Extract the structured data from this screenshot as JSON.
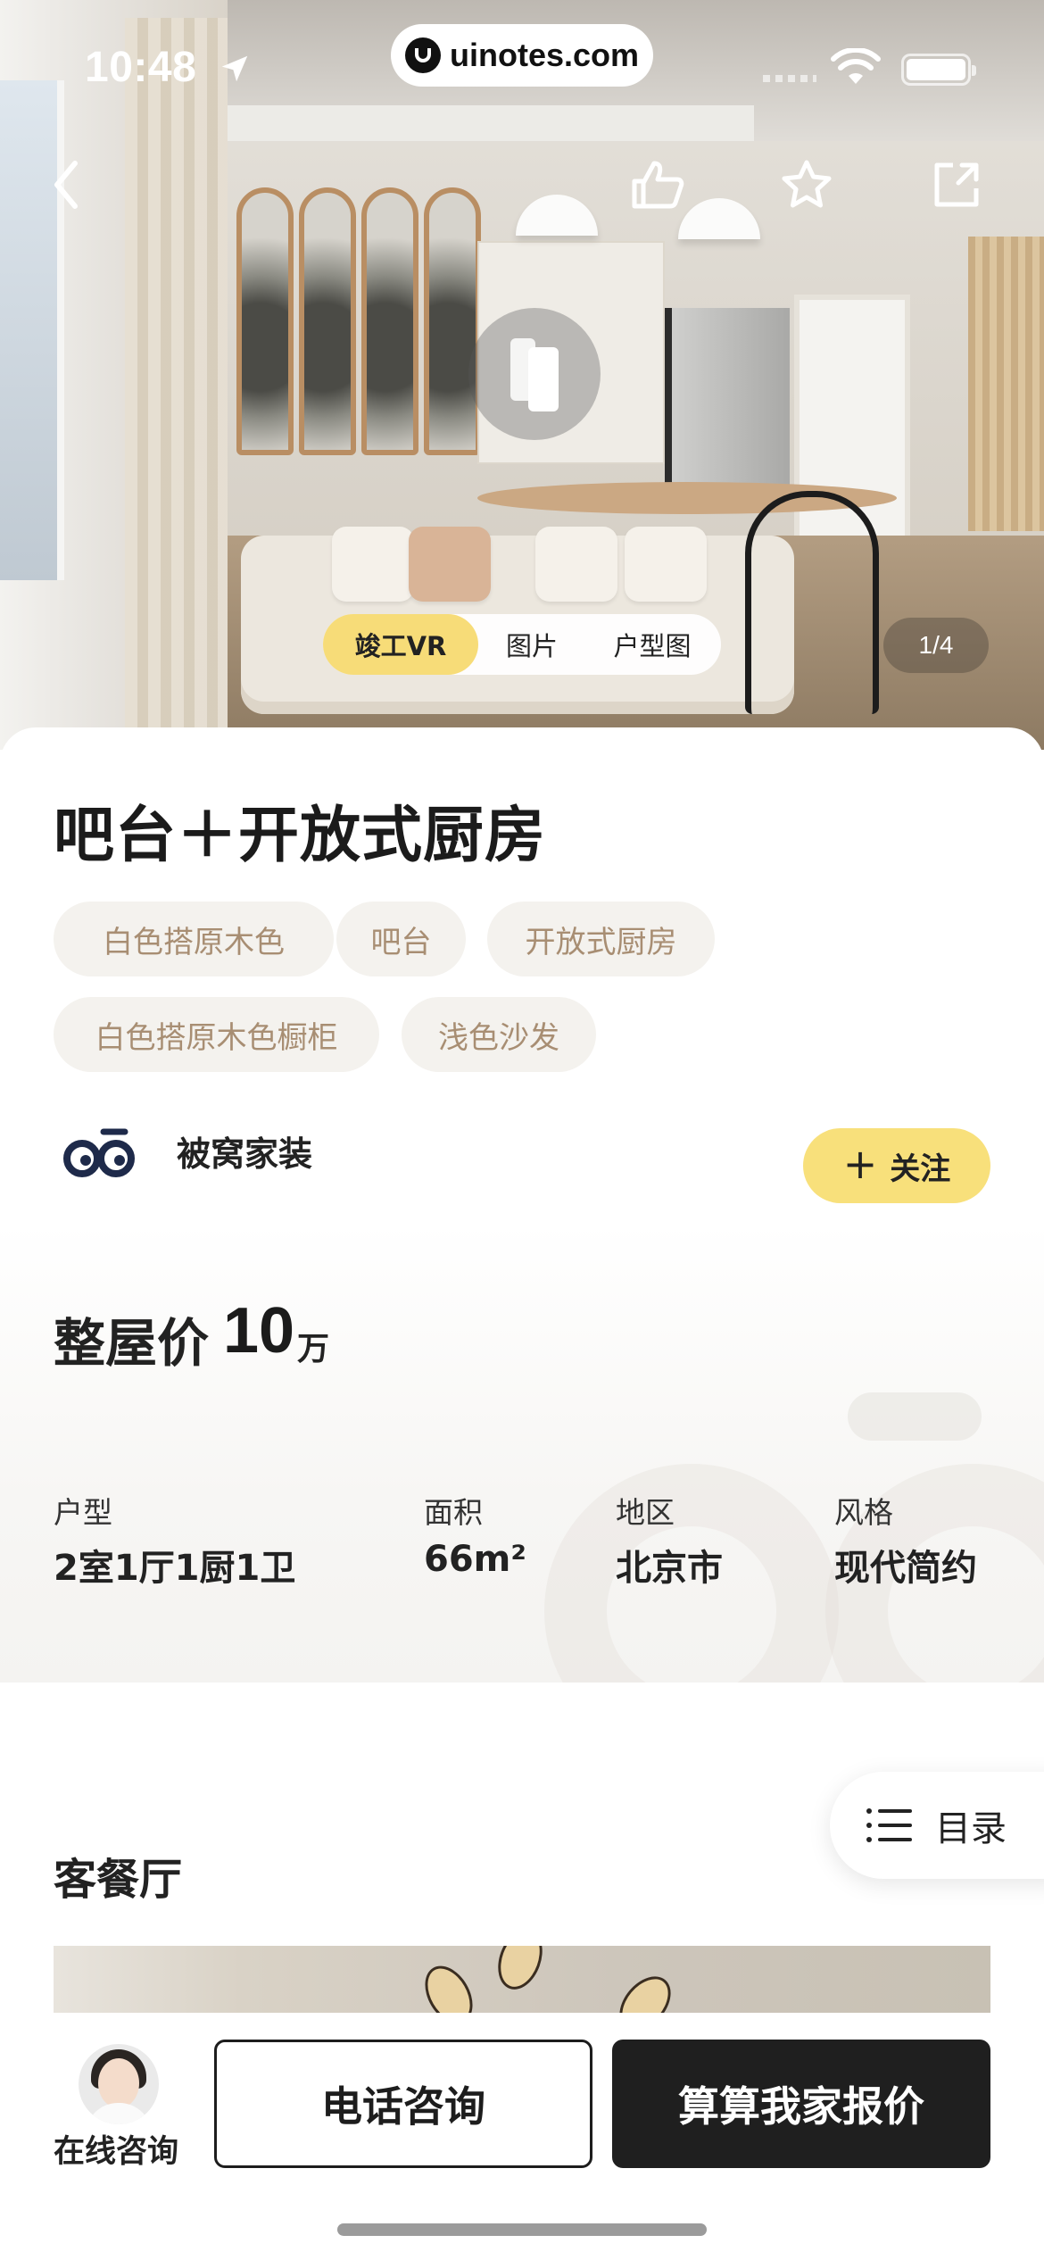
{
  "status_bar": {
    "time": "10:48",
    "url": "uinotes.com"
  },
  "hero": {
    "media_tabs": [
      {
        "label": "竣工VR",
        "active": true
      },
      {
        "label": "图片",
        "active": false
      },
      {
        "label": "户型图",
        "active": false
      }
    ],
    "counter": "1/4",
    "icons": {
      "back": "chevron-left-icon",
      "like": "thumbs-up-icon",
      "favorite": "star-icon",
      "share": "share-icon",
      "vr": "vr-play-icon"
    }
  },
  "case": {
    "title": "吧台＋开放式厨房",
    "tags": [
      "白色搭原木色",
      "吧台",
      "开放式厨房",
      "白色搭原木色橱柜",
      "浅色沙发"
    ]
  },
  "brand": {
    "name": "被窝家装",
    "follow_label": "关注"
  },
  "price": {
    "label": "整屋价",
    "value": "10",
    "unit": "万"
  },
  "specs": [
    {
      "label": "户型",
      "value": "2室1厅1厨1卫"
    },
    {
      "label": "面积",
      "value": "66m²"
    },
    {
      "label": "地区",
      "value": "北京市"
    },
    {
      "label": "风格",
      "value": "现代简约"
    }
  ],
  "toc": {
    "label": "目录"
  },
  "section": {
    "title": "客餐厅"
  },
  "bottom_bar": {
    "online_label": "在线咨询",
    "call_label": "电话咨询",
    "quote_label": "算算我家报价"
  },
  "colors": {
    "accent_yellow": "#F8E07B",
    "tag_text": "#A88E73",
    "tag_bg": "#F4F2EE",
    "dark": "#1F1F1F"
  }
}
